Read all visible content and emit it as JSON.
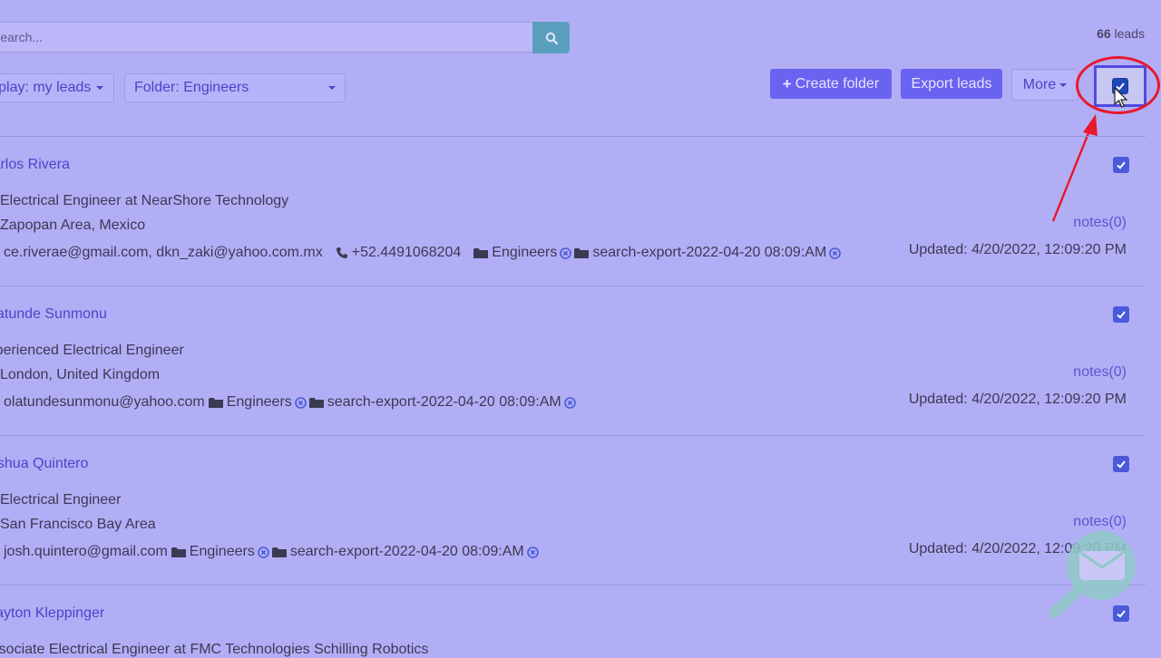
{
  "search": {
    "placeholder": "Search...",
    "value": ""
  },
  "leads_count": {
    "number": "66",
    "label": "leads"
  },
  "filters": {
    "display_label": "Display: my leads",
    "folder_label": "Folder: Engineers"
  },
  "toolbar": {
    "create_folder_label": "Create folder",
    "export_leads_label": "Export leads",
    "more_label": "More",
    "select_all_checked": true
  },
  "leads": [
    {
      "name": "Carlos Rivera",
      "title": "Electrical Engineer at NearShore Technology",
      "location": "Zapopan Area, Mexico",
      "emails": "ce.riverae@gmail.com, dkn_zaki@yahoo.com.mx",
      "phone": "+52.4491068204",
      "folders": [
        "Engineers",
        "search-export-2022-04-20 08:09:AM"
      ],
      "notes": "notes(0)",
      "updated": "Updated: 4/20/2022, 12:09:20 PM",
      "checked": true
    },
    {
      "name": "Olatunde Sunmonu",
      "title": "Experienced Electrical Engineer",
      "location": "London, United Kingdom",
      "emails": "olatundesunmonu@yahoo.com",
      "phone": "",
      "folders": [
        "Engineers",
        "search-export-2022-04-20 08:09:AM"
      ],
      "notes": "notes(0)",
      "updated": "Updated: 4/20/2022, 12:09:20 PM",
      "checked": true
    },
    {
      "name": "Joshua Quintero",
      "title": "Electrical Engineer",
      "location": "San Francisco Bay Area",
      "emails": "josh.quintero@gmail.com",
      "phone": "",
      "folders": [
        "Engineers",
        "search-export-2022-04-20 08:09:AM"
      ],
      "notes": "notes(0)",
      "updated": "Updated: 4/20/2022, 12:09:20 PM",
      "checked": true
    },
    {
      "name": "Clayton Kleppinger",
      "title": "Associate Electrical Engineer at FMC Technologies Schilling Robotics",
      "location": "",
      "emails": "",
      "phone": "",
      "folders": [],
      "notes": "",
      "updated": "",
      "checked": true
    }
  ],
  "colors": {
    "overlay": "#b2aef6",
    "primary_button": "#6a63f0",
    "link": "#4a44c8",
    "checkbox": "#4a5ad8",
    "highlight": "#e8192c"
  }
}
